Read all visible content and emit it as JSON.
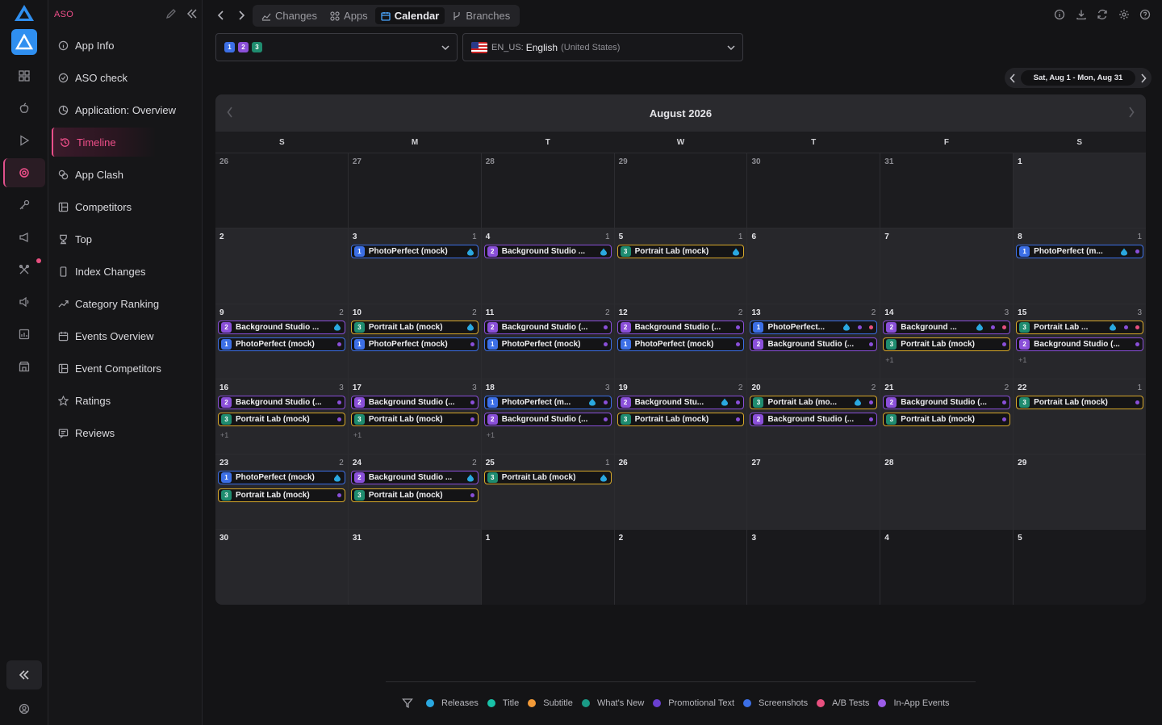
{
  "sidebar": {
    "section_title": "ASO",
    "items": [
      {
        "label": "App Info",
        "icon": "info-icon"
      },
      {
        "label": "ASO check",
        "icon": "check-circle-icon"
      },
      {
        "label": "Application: Overview",
        "icon": "pie-chart-icon"
      },
      {
        "label": "Timeline",
        "icon": "history-icon",
        "active": true
      },
      {
        "label": "App Clash",
        "icon": "clash-icon"
      },
      {
        "label": "Competitors",
        "icon": "competitors-icon"
      },
      {
        "label": "Top",
        "icon": "trophy-icon"
      },
      {
        "label": "Index Changes",
        "icon": "phone-icon"
      },
      {
        "label": "Category Ranking",
        "icon": "trend-icon"
      },
      {
        "label": "Events Overview",
        "icon": "calendar-icon"
      },
      {
        "label": "Event Competitors",
        "icon": "competitors-icon"
      },
      {
        "label": "Ratings",
        "icon": "star-icon"
      },
      {
        "label": "Reviews",
        "icon": "reviews-icon"
      }
    ]
  },
  "toolbar": {
    "tabs": [
      {
        "label": "Changes",
        "icon": "chart-icon"
      },
      {
        "label": "Apps",
        "icon": "apps-icon"
      },
      {
        "label": "Calendar",
        "icon": "calendar-icon",
        "active": true
      },
      {
        "label": "Branches",
        "icon": "branch-icon"
      }
    ]
  },
  "filters": {
    "app_badges": [
      "1",
      "2",
      "3"
    ],
    "locale_code": "EN_US:",
    "locale_name": "English",
    "locale_region": "(United States)"
  },
  "date_range": "Sat, Aug 1 - Mon, Aug 31",
  "calendar": {
    "month": "August 2026",
    "weekdays": [
      "S",
      "M",
      "T",
      "W",
      "T",
      "F",
      "S"
    ]
  },
  "apps": {
    "1": {
      "name": "PhotoPerfect (mock)",
      "color": "#3c6fe6"
    },
    "2": {
      "name": "Background Studio (mock)",
      "color": "#8a4fd9"
    },
    "3": {
      "name": "Portrait Lab (mock)",
      "color": "#d8a92a"
    }
  },
  "event_colors": {
    "release": "#2aa8e0",
    "promotional": "#8a4fd9",
    "ab": "#e8507f",
    "title": "#19c2a8",
    "subtitle": "#f29a38",
    "whats_new": "#1a9a86",
    "screenshots": "#3c6fe6",
    "inapp": "#9b5be8"
  },
  "weeks": [
    [
      {
        "num": "26",
        "other": true
      },
      {
        "num": "27",
        "other": true
      },
      {
        "num": "28",
        "other": true
      },
      {
        "num": "29",
        "other": true
      },
      {
        "num": "30",
        "other": true
      },
      {
        "num": "31",
        "other": true
      },
      {
        "num": "1"
      }
    ],
    [
      {
        "num": "2"
      },
      {
        "num": "3",
        "count": "1",
        "events": [
          {
            "app": "1",
            "title": "PhotoPerfect (mock)",
            "dots": [
              "release"
            ]
          }
        ]
      },
      {
        "num": "4",
        "count": "1",
        "events": [
          {
            "app": "2",
            "title": "Background Studio ...",
            "dots": [
              "release"
            ]
          }
        ]
      },
      {
        "num": "5",
        "count": "1",
        "events": [
          {
            "app": "3",
            "title": "Portrait Lab (mock)",
            "dots": [
              "release"
            ]
          }
        ]
      },
      {
        "num": "6"
      },
      {
        "num": "7"
      },
      {
        "num": "8",
        "count": "1",
        "events": [
          {
            "app": "1",
            "title": "PhotoPerfect (m...",
            "dots": [
              "release",
              "promotional"
            ]
          }
        ]
      }
    ],
    [
      {
        "num": "9",
        "count": "2",
        "events": [
          {
            "app": "2",
            "title": "Background Studio ...",
            "dots": [
              "release"
            ]
          },
          {
            "app": "1",
            "title": "PhotoPerfect (mock)",
            "dots": [
              "promotional"
            ]
          }
        ]
      },
      {
        "num": "10",
        "count": "2",
        "events": [
          {
            "app": "3",
            "title": "Portrait Lab (mock)",
            "dots": [
              "release"
            ]
          },
          {
            "app": "1",
            "title": "PhotoPerfect (mock)",
            "dots": [
              "promotional"
            ]
          }
        ]
      },
      {
        "num": "11",
        "count": "2",
        "events": [
          {
            "app": "2",
            "title": "Background Studio (...",
            "dots": [
              "promotional"
            ]
          },
          {
            "app": "1",
            "title": "PhotoPerfect (mock)",
            "dots": [
              "promotional"
            ]
          }
        ]
      },
      {
        "num": "12",
        "count": "2",
        "events": [
          {
            "app": "2",
            "title": "Background Studio (...",
            "dots": [
              "promotional"
            ]
          },
          {
            "app": "1",
            "title": "PhotoPerfect (mock)",
            "dots": [
              "promotional"
            ]
          }
        ]
      },
      {
        "num": "13",
        "count": "2",
        "events": [
          {
            "app": "1",
            "title": "PhotoPerfect...",
            "dots": [
              "release",
              "promotional",
              "ab"
            ]
          },
          {
            "app": "2",
            "title": "Background Studio (...",
            "dots": [
              "promotional"
            ]
          }
        ]
      },
      {
        "num": "14",
        "count": "3",
        "more": "+1",
        "events": [
          {
            "app": "2",
            "title": "Background ...",
            "dots": [
              "release",
              "promotional",
              "ab"
            ]
          },
          {
            "app": "3",
            "title": "Portrait Lab (mock)",
            "dots": [
              "promotional"
            ]
          }
        ]
      },
      {
        "num": "15",
        "count": "3",
        "more": "+1",
        "events": [
          {
            "app": "3",
            "title": "Portrait Lab ...",
            "dots": [
              "release",
              "promotional",
              "ab"
            ]
          },
          {
            "app": "2",
            "title": "Background Studio (...",
            "dots": [
              "promotional"
            ]
          }
        ]
      }
    ],
    [
      {
        "num": "16",
        "count": "3",
        "more": "+1",
        "events": [
          {
            "app": "2",
            "title": "Background Studio (...",
            "dots": [
              "promotional"
            ]
          },
          {
            "app": "3",
            "title": "Portrait Lab (mock)",
            "dots": [
              "promotional"
            ]
          }
        ]
      },
      {
        "num": "17",
        "count": "3",
        "more": "+1",
        "events": [
          {
            "app": "2",
            "title": "Background Studio (...",
            "dots": [
              "promotional"
            ]
          },
          {
            "app": "3",
            "title": "Portrait Lab (mock)",
            "dots": [
              "promotional"
            ]
          }
        ]
      },
      {
        "num": "18",
        "count": "3",
        "more": "+1",
        "events": [
          {
            "app": "1",
            "title": "PhotoPerfect (m...",
            "dots": [
              "release",
              "promotional"
            ]
          },
          {
            "app": "2",
            "title": "Background Studio (...",
            "dots": [
              "promotional"
            ]
          }
        ]
      },
      {
        "num": "19",
        "count": "2",
        "events": [
          {
            "app": "2",
            "title": "Background Stu...",
            "dots": [
              "release",
              "promotional"
            ]
          },
          {
            "app": "3",
            "title": "Portrait Lab (mock)",
            "dots": [
              "promotional"
            ]
          }
        ]
      },
      {
        "num": "20",
        "count": "2",
        "events": [
          {
            "app": "3",
            "title": "Portrait Lab (mo...",
            "dots": [
              "release",
              "promotional"
            ]
          },
          {
            "app": "2",
            "title": "Background Studio (...",
            "dots": [
              "promotional"
            ]
          }
        ]
      },
      {
        "num": "21",
        "count": "2",
        "events": [
          {
            "app": "2",
            "title": "Background Studio (...",
            "dots": [
              "promotional"
            ]
          },
          {
            "app": "3",
            "title": "Portrait Lab (mock)",
            "dots": [
              "promotional"
            ]
          }
        ]
      },
      {
        "num": "22",
        "count": "1",
        "events": [
          {
            "app": "3",
            "title": "Portrait Lab (mock)",
            "dots": [
              "promotional"
            ]
          }
        ]
      }
    ],
    [
      {
        "num": "23",
        "count": "2",
        "events": [
          {
            "app": "1",
            "title": "PhotoPerfect (mock)",
            "dots": [
              "release"
            ]
          },
          {
            "app": "3",
            "title": "Portrait Lab (mock)",
            "dots": [
              "promotional"
            ]
          }
        ]
      },
      {
        "num": "24",
        "count": "2",
        "events": [
          {
            "app": "2",
            "title": "Background Studio ...",
            "dots": [
              "release"
            ]
          },
          {
            "app": "3",
            "title": "Portrait Lab (mock)",
            "dots": [
              "promotional"
            ]
          }
        ]
      },
      {
        "num": "25",
        "count": "1",
        "events": [
          {
            "app": "3",
            "title": "Portrait Lab (mock)",
            "dots": [
              "release"
            ]
          }
        ]
      },
      {
        "num": "26"
      },
      {
        "num": "27"
      },
      {
        "num": "28"
      },
      {
        "num": "29"
      }
    ],
    [
      {
        "num": "30"
      },
      {
        "num": "31"
      },
      {
        "num": "1",
        "dim": true
      },
      {
        "num": "2",
        "dim": true
      },
      {
        "num": "3",
        "dim": true
      },
      {
        "num": "4",
        "dim": true
      },
      {
        "num": "5",
        "dim": true
      }
    ]
  ],
  "legend": [
    {
      "label": "Releases",
      "color": "#2aa8e0"
    },
    {
      "label": "Title",
      "color": "#19c2a8"
    },
    {
      "label": "Subtitle",
      "color": "#f29a38"
    },
    {
      "label": "What's New",
      "color": "#1a9a86"
    },
    {
      "label": "Promotional Text",
      "color": "#6a3fd0"
    },
    {
      "label": "Screenshots",
      "color": "#3c6fe6"
    },
    {
      "label": "A/B Tests",
      "color": "#e8507f"
    },
    {
      "label": "In-App Events",
      "color": "#9b5be8"
    }
  ]
}
